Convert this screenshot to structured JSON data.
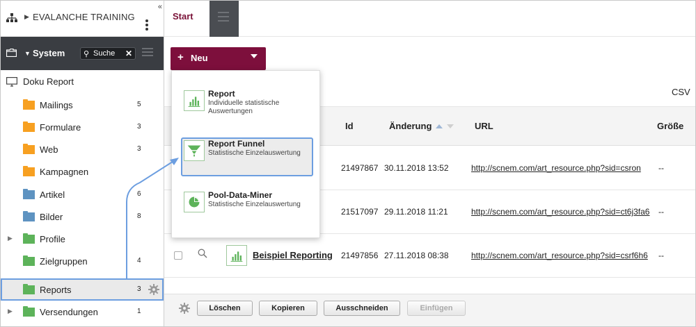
{
  "org": {
    "name": "EVALANCHE TRAINING"
  },
  "system": {
    "label": "System",
    "search_placeholder": "Suche"
  },
  "tree": {
    "root": {
      "label": "Doku Report"
    },
    "items": [
      {
        "label": "Mailings",
        "count": "5",
        "color": "#f7a021"
      },
      {
        "label": "Formulare",
        "count": "3",
        "color": "#f7a021"
      },
      {
        "label": "Web",
        "count": "3",
        "color": "#f7a021"
      },
      {
        "label": "Kampagnen",
        "count": "",
        "color": "#f7a021"
      },
      {
        "label": "Artikel",
        "count": "6",
        "color": "#5e93c1"
      },
      {
        "label": "Bilder",
        "count": "8",
        "color": "#5e93c1"
      },
      {
        "label": "Profile",
        "count": "",
        "color": "#5db35a"
      },
      {
        "label": "Zielgruppen",
        "count": "4",
        "color": "#5db35a"
      },
      {
        "label": "Reports",
        "count": "3",
        "color": "#5db35a"
      },
      {
        "label": "Versendungen",
        "count": "1",
        "color": "#5db35a"
      }
    ]
  },
  "tabs": {
    "start": "Start"
  },
  "toolbar": {
    "new_label": "Neu",
    "csv_label": "CSV"
  },
  "dropdown": {
    "items": [
      {
        "title": "Report",
        "desc": "Individuelle statistische Auswertungen"
      },
      {
        "title": "Report Funnel",
        "desc": "Statistische Einzelauswertung"
      },
      {
        "title": "Pool-Data-Miner",
        "desc": "Statistische Einzelauswertung"
      }
    ]
  },
  "table": {
    "headers": {
      "id": "Id",
      "changed": "Änderung",
      "url": "URL",
      "size": "Größe"
    },
    "rows": [
      {
        "name": "",
        "id": "21497867",
        "changed": "30.11.2018 13:52",
        "url": "http://scnem.com/art_resource.php?sid=csron",
        "size": "--"
      },
      {
        "name": "",
        "id": "21517097",
        "changed": "29.11.2018 11:21",
        "url": "http://scnem.com/art_resource.php?sid=ct6j3fa6",
        "size": "--"
      },
      {
        "name": "Beispiel Reporting",
        "id": "21497856",
        "changed": "27.11.2018 08:38",
        "url": "http://scnem.com/art_resource.php?sid=csrf6h6",
        "size": "--"
      }
    ]
  },
  "footer": {
    "delete": "Löschen",
    "copy": "Kopieren",
    "cut": "Ausschneiden",
    "paste": "Einfügen"
  },
  "colors": {
    "accent": "#7d0f3c",
    "highlight": "#6c9ee0",
    "sidebar_dark": "#3a3d42"
  }
}
